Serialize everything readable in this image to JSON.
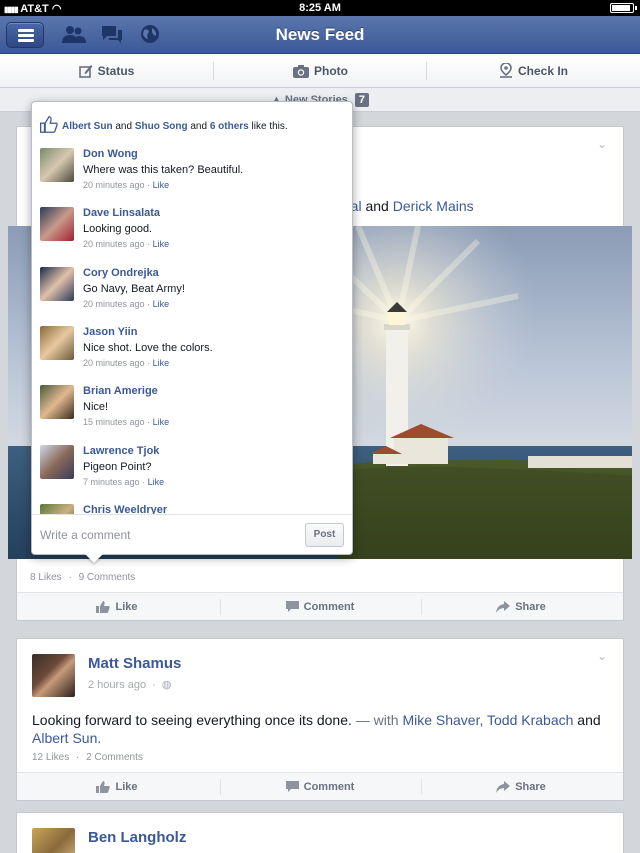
{
  "status_bar": {
    "carrier": "AT&T",
    "time": "8:25 AM"
  },
  "nav": {
    "title": "News Feed"
  },
  "composer": {
    "status": "Status",
    "photo": "Photo",
    "checkin": "Check In"
  },
  "new_stories": {
    "label": "New Stories",
    "count": "7"
  },
  "post1": {
    "visible_tagline_end": "thal",
    "and_text": "and",
    "tag_name": "Derick Mains",
    "likes": "8 Likes",
    "comments": "9 Comments",
    "actions": {
      "like": "Like",
      "comment": "Comment",
      "share": "Share"
    }
  },
  "popover": {
    "likers": {
      "a": "Albert Sun",
      "and1": "and",
      "b": "Shuo Song",
      "and2": "and",
      "others": "6 others",
      "tail": "like this."
    },
    "comments": [
      {
        "name": "Don Wong",
        "text": "Where was this taken? Beautiful.",
        "time": "20 minutes ago",
        "like": "Like"
      },
      {
        "name": "Dave Linsalata",
        "text": "Looking good.",
        "time": "20 minutes ago",
        "like": "Like"
      },
      {
        "name": "Cory Ondrejka",
        "text": "Go Navy, Beat Army!",
        "time": "20 minutes ago",
        "like": "Like"
      },
      {
        "name": "Jason Yiin",
        "text": "Nice shot.  Love the colors.",
        "time": "20 minutes ago",
        "like": "Like"
      },
      {
        "name": "Brian Amerige",
        "text": "Nice!",
        "time": "15 minutes ago",
        "like": "Like"
      },
      {
        "name": "Lawrence Tjok",
        "text": "Pigeon Point?",
        "time": "7 minutes ago",
        "like": "Like"
      },
      {
        "name": "Chris Weeldryer",
        "text": "",
        "time": "",
        "like": ""
      }
    ],
    "placeholder": "Write a comment",
    "post_label": "Post",
    "separator": "·"
  },
  "post2": {
    "author": "Matt Shamus",
    "time": "2 hours ago",
    "separator": "·",
    "text": "Looking forward to seeing everything once its done.",
    "with": "— with",
    "tags": "Mike Shaver, Todd Krabach",
    "and_text": "and",
    "last_tag": "Albert Sun.",
    "likes": "12 Likes",
    "comments": "2 Comments",
    "actions": {
      "like": "Like",
      "comment": "Comment",
      "share": "Share"
    }
  },
  "post3": {
    "author": "Ben Langholz"
  },
  "colors": {
    "brand": "#3b5998",
    "link": "#3b5998",
    "muted": "#90949c",
    "background": "#d3d6db"
  },
  "icons": [
    "menu-icon",
    "friend-requests-icon",
    "messages-icon",
    "notifications-globe-icon",
    "status-edit-icon",
    "camera-icon",
    "checkin-pin-icon",
    "thumbs-up-icon",
    "comment-bubble-icon",
    "share-arrow-icon",
    "globe-icon",
    "chevron-down-icon"
  ]
}
